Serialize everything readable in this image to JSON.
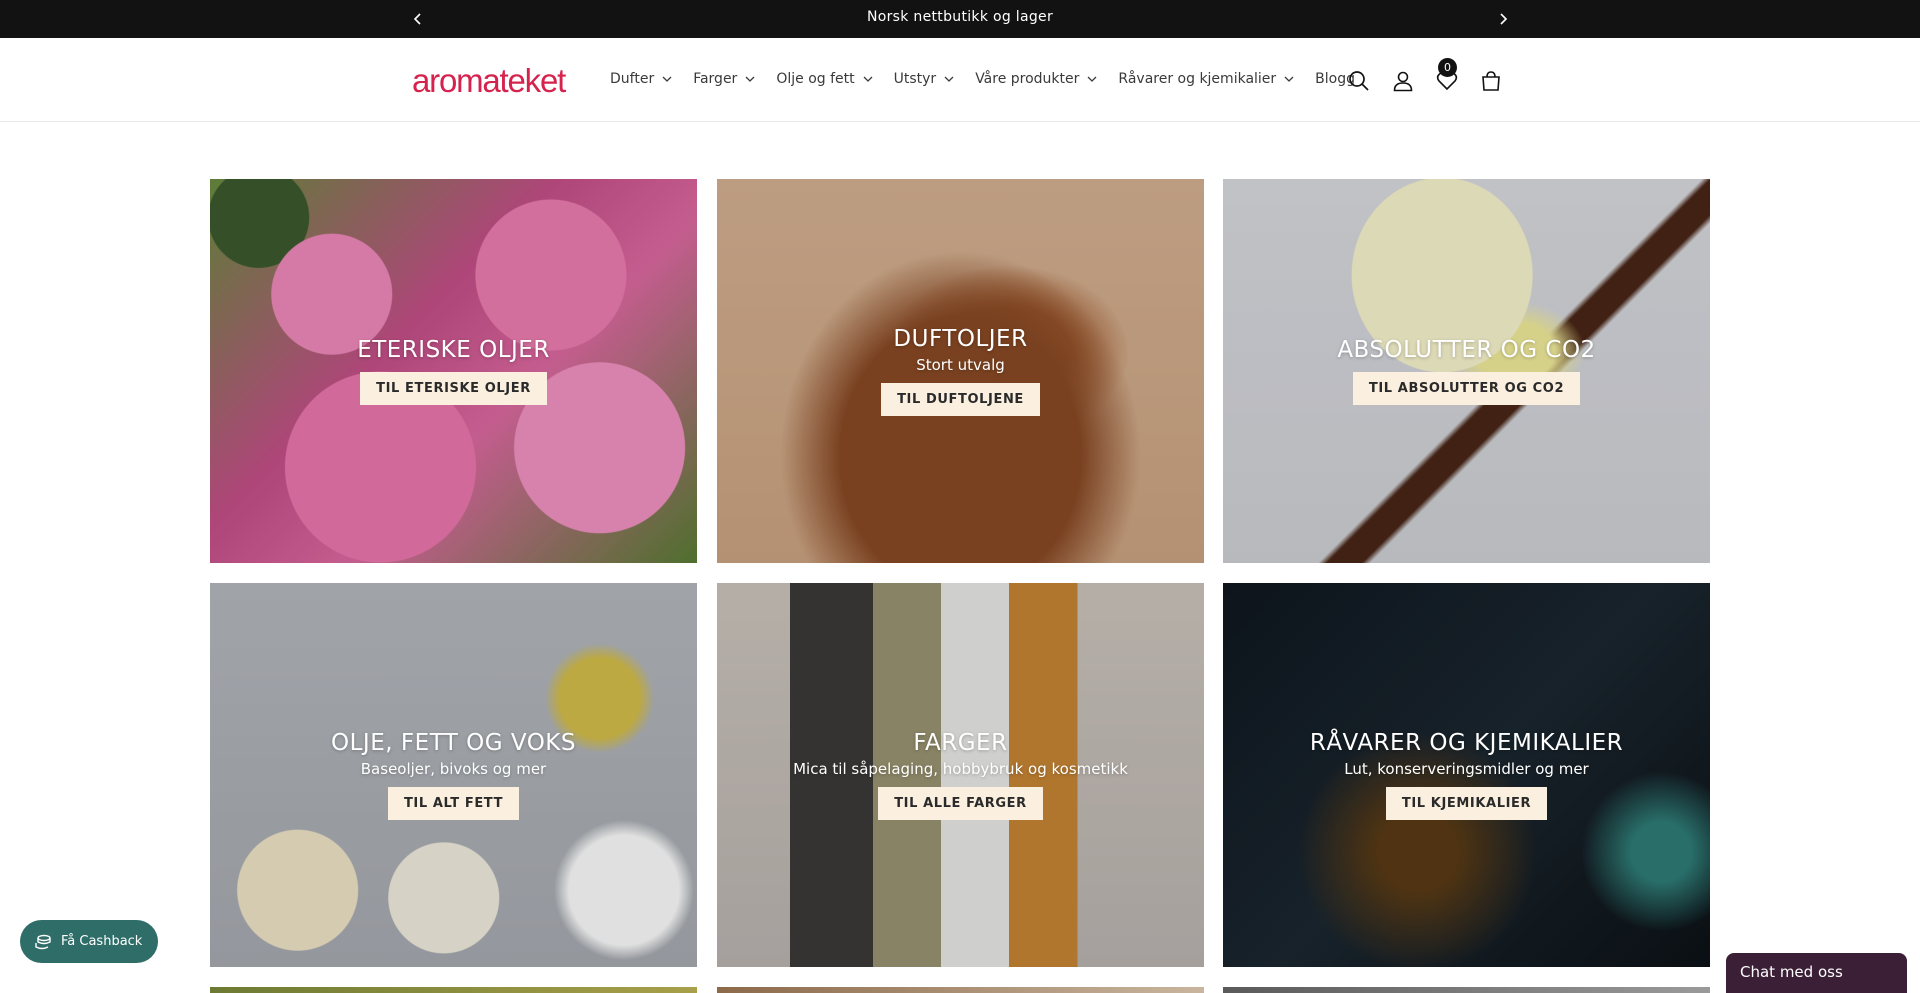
{
  "announcement": {
    "message": "Norsk nettbutikk og lager",
    "prev_icon": "chevron-left-icon",
    "next_icon": "chevron-right-icon"
  },
  "header": {
    "logo_text": "aromateket",
    "logo_color": "#d5234e",
    "nav": [
      {
        "label": "Dufter"
      },
      {
        "label": "Farger"
      },
      {
        "label": "Olje og fett"
      },
      {
        "label": "Utstyr"
      },
      {
        "label": "Våre produkter"
      },
      {
        "label": "Råvarer og kjemikalier"
      },
      {
        "label": "Blogg"
      }
    ],
    "wishlist_count": "0"
  },
  "collections": [
    {
      "title": "ETERISKE OLJER",
      "subtitle": "",
      "button": "TIL ETERISKE OLJER"
    },
    {
      "title": "DUFTOLJER",
      "subtitle": "Stort utvalg",
      "button": "TIL DUFTOLJENE"
    },
    {
      "title": "ABSOLUTTER OG CO2",
      "subtitle": "",
      "button": "TIL ABSOLUTTER OG CO2"
    },
    {
      "title": "OLJE, FETT OG VOKS",
      "subtitle": "Baseoljer, bivoks og mer",
      "button": "TIL ALT FETT"
    },
    {
      "title": "FARGER",
      "subtitle": "Mica til såpelaging, hobbybruk og kosmetikk",
      "button": "TIL ALLE FARGER"
    },
    {
      "title": "RÅVARER OG KJEMIKALIER",
      "subtitle": "Lut, konserveringsmidler og mer",
      "button": "TIL KJEMIKALIER"
    }
  ],
  "widgets": {
    "cashback_label": "Få Cashback",
    "cashback_color": "#2f6e68",
    "chat_label": "Chat med oss",
    "chat_color": "#3b1f37"
  }
}
